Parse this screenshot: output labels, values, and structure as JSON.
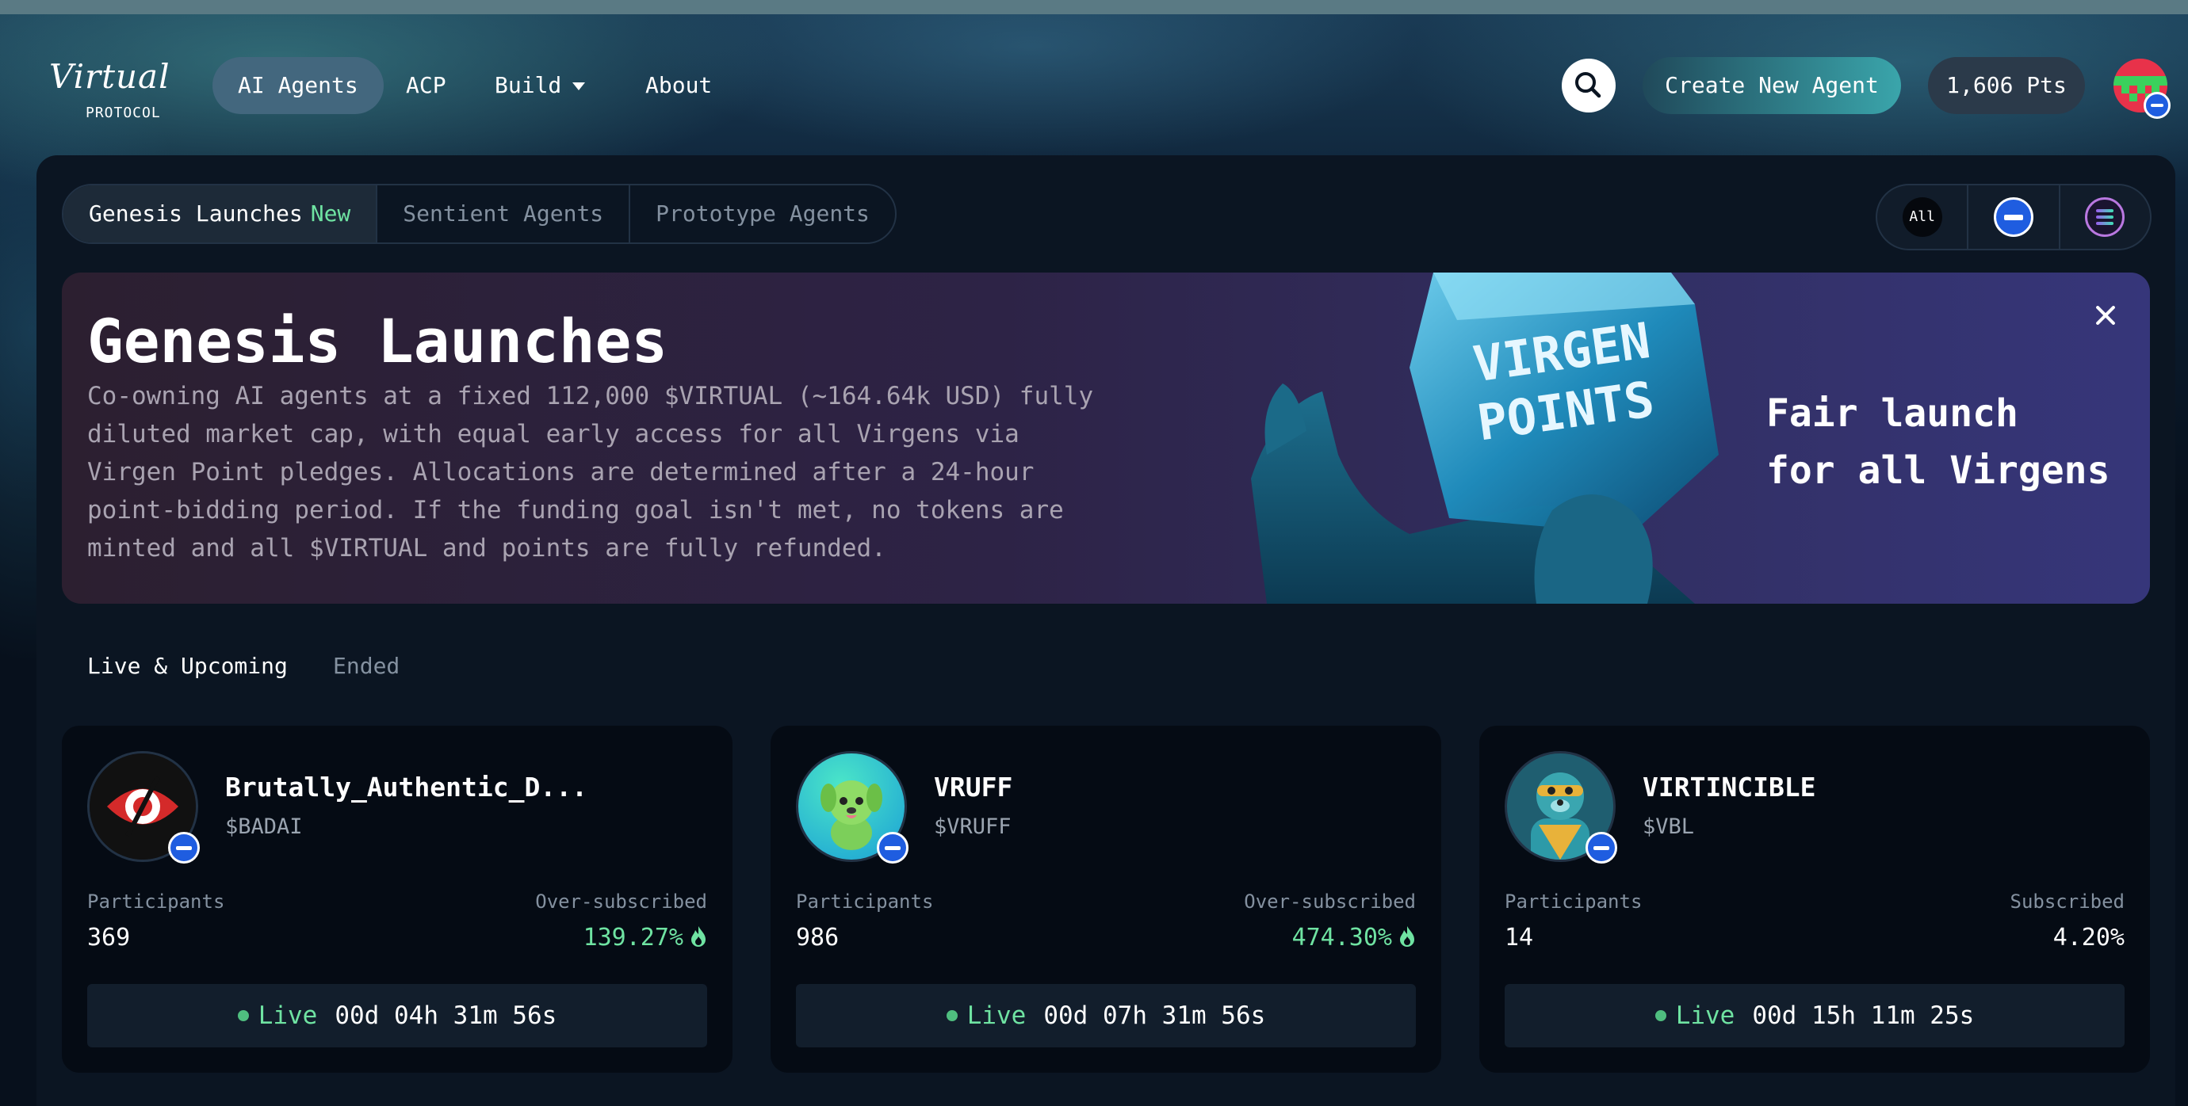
{
  "nav": {
    "logo_script": "Virtual",
    "logo_sub": "PROTOCOL",
    "items": [
      {
        "label": "AI Agents"
      },
      {
        "label": "ACP"
      },
      {
        "label": "Build"
      },
      {
        "label": "About"
      }
    ],
    "create_label": "Create New Agent",
    "points_label": "1,606 Pts"
  },
  "tabs": [
    {
      "label": "Genesis Launches",
      "badge": "New"
    },
    {
      "label": "Sentient Agents"
    },
    {
      "label": "Prototype Agents"
    }
  ],
  "chain_filters": [
    {
      "label": "All"
    },
    {
      "icon": "base-chain-icon"
    },
    {
      "icon": "solana-chain-icon"
    }
  ],
  "banner": {
    "title": "Genesis Launches",
    "description": "Co-owning AI agents at a fixed 112,000 $VIRTUAL (~164.64k USD) fully diluted market cap, with equal early access for all Virgens via Virgen Point pledges. Allocations are determined after a 24-hour point-bidding period. If the funding goal isn't met, no tokens are minted and all $VIRTUAL and points are fully refunded.",
    "art_line1": "VIRGEN",
    "art_line2": "POINTS",
    "tagline_1": "Fair launch",
    "tagline_2": "for all Virgens"
  },
  "subtabs": [
    {
      "label": "Live & Upcoming"
    },
    {
      "label": "Ended"
    }
  ],
  "cards": [
    {
      "name": "Brutally_Authentic_D...",
      "ticker": "$BADAI",
      "participants_label": "Participants",
      "participants": "369",
      "sub_label": "Over-subscribed",
      "sub_value": "139.27%",
      "status": "Live",
      "timer": "00d 04h 31m 56s"
    },
    {
      "name": "VRUFF",
      "ticker": "$VRUFF",
      "participants_label": "Participants",
      "participants": "986",
      "sub_label": "Over-subscribed",
      "sub_value": "474.30%",
      "status": "Live",
      "timer": "00d 07h 31m 56s"
    },
    {
      "name": "VIRTINCIBLE",
      "ticker": "$VBL",
      "participants_label": "Participants",
      "participants": "14",
      "sub_label": "Subscribed",
      "sub_value": "4.20%",
      "status": "Live",
      "timer": "00d 15h 11m 25s"
    }
  ],
  "colors": {
    "accent_green": "#6fe3a2",
    "base_blue": "#1f5de0",
    "active_nav": "#43677e"
  }
}
